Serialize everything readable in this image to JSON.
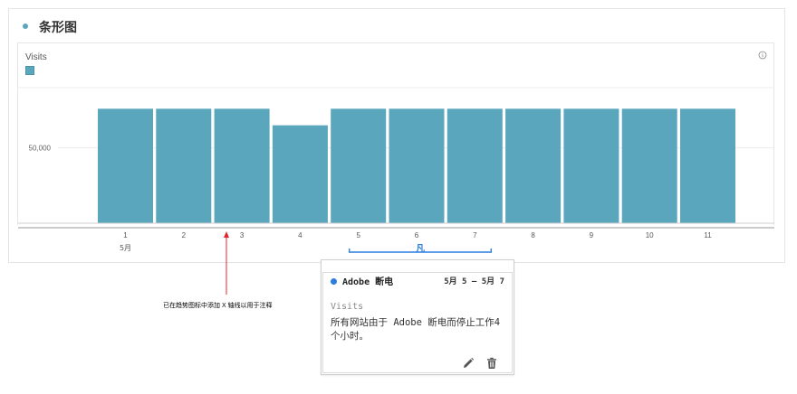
{
  "panel": {
    "title": "条形图"
  },
  "chart_data": {
    "type": "bar",
    "series": [
      {
        "name": "Visits",
        "color": "#5aa6bd",
        "values": [
          76000,
          76000,
          76000,
          65000,
          76000,
          76000,
          76000,
          76000,
          76000,
          76000,
          76000
        ]
      }
    ],
    "categories": [
      "1",
      "2",
      "3",
      "4",
      "5",
      "6",
      "7",
      "8",
      "9",
      "10",
      "11"
    ],
    "x_sublabel": "5月",
    "ytick_labels": [
      "50,000"
    ],
    "y_ticks": [
      50000
    ],
    "ylim": [
      0,
      90000
    ],
    "grid": true,
    "legend": "top-left"
  },
  "annotation_range": {
    "label": "凡",
    "start": "5",
    "end": "7",
    "color": "#2b7de0"
  },
  "side_note": {
    "text": "已在趋势图标中添加 X 轴线以用于注释",
    "arrow_color": "#e0262d"
  },
  "annotation_card": {
    "title": "Adobe 断电",
    "date": "5月 5 – 5月 7",
    "metric": "Visits",
    "description": "所有网站由于 Adobe 断电而停止工作4个小时。",
    "dot_color": "#2b7de0",
    "edit_icon": "pencil-icon",
    "delete_icon": "trash-icon"
  }
}
